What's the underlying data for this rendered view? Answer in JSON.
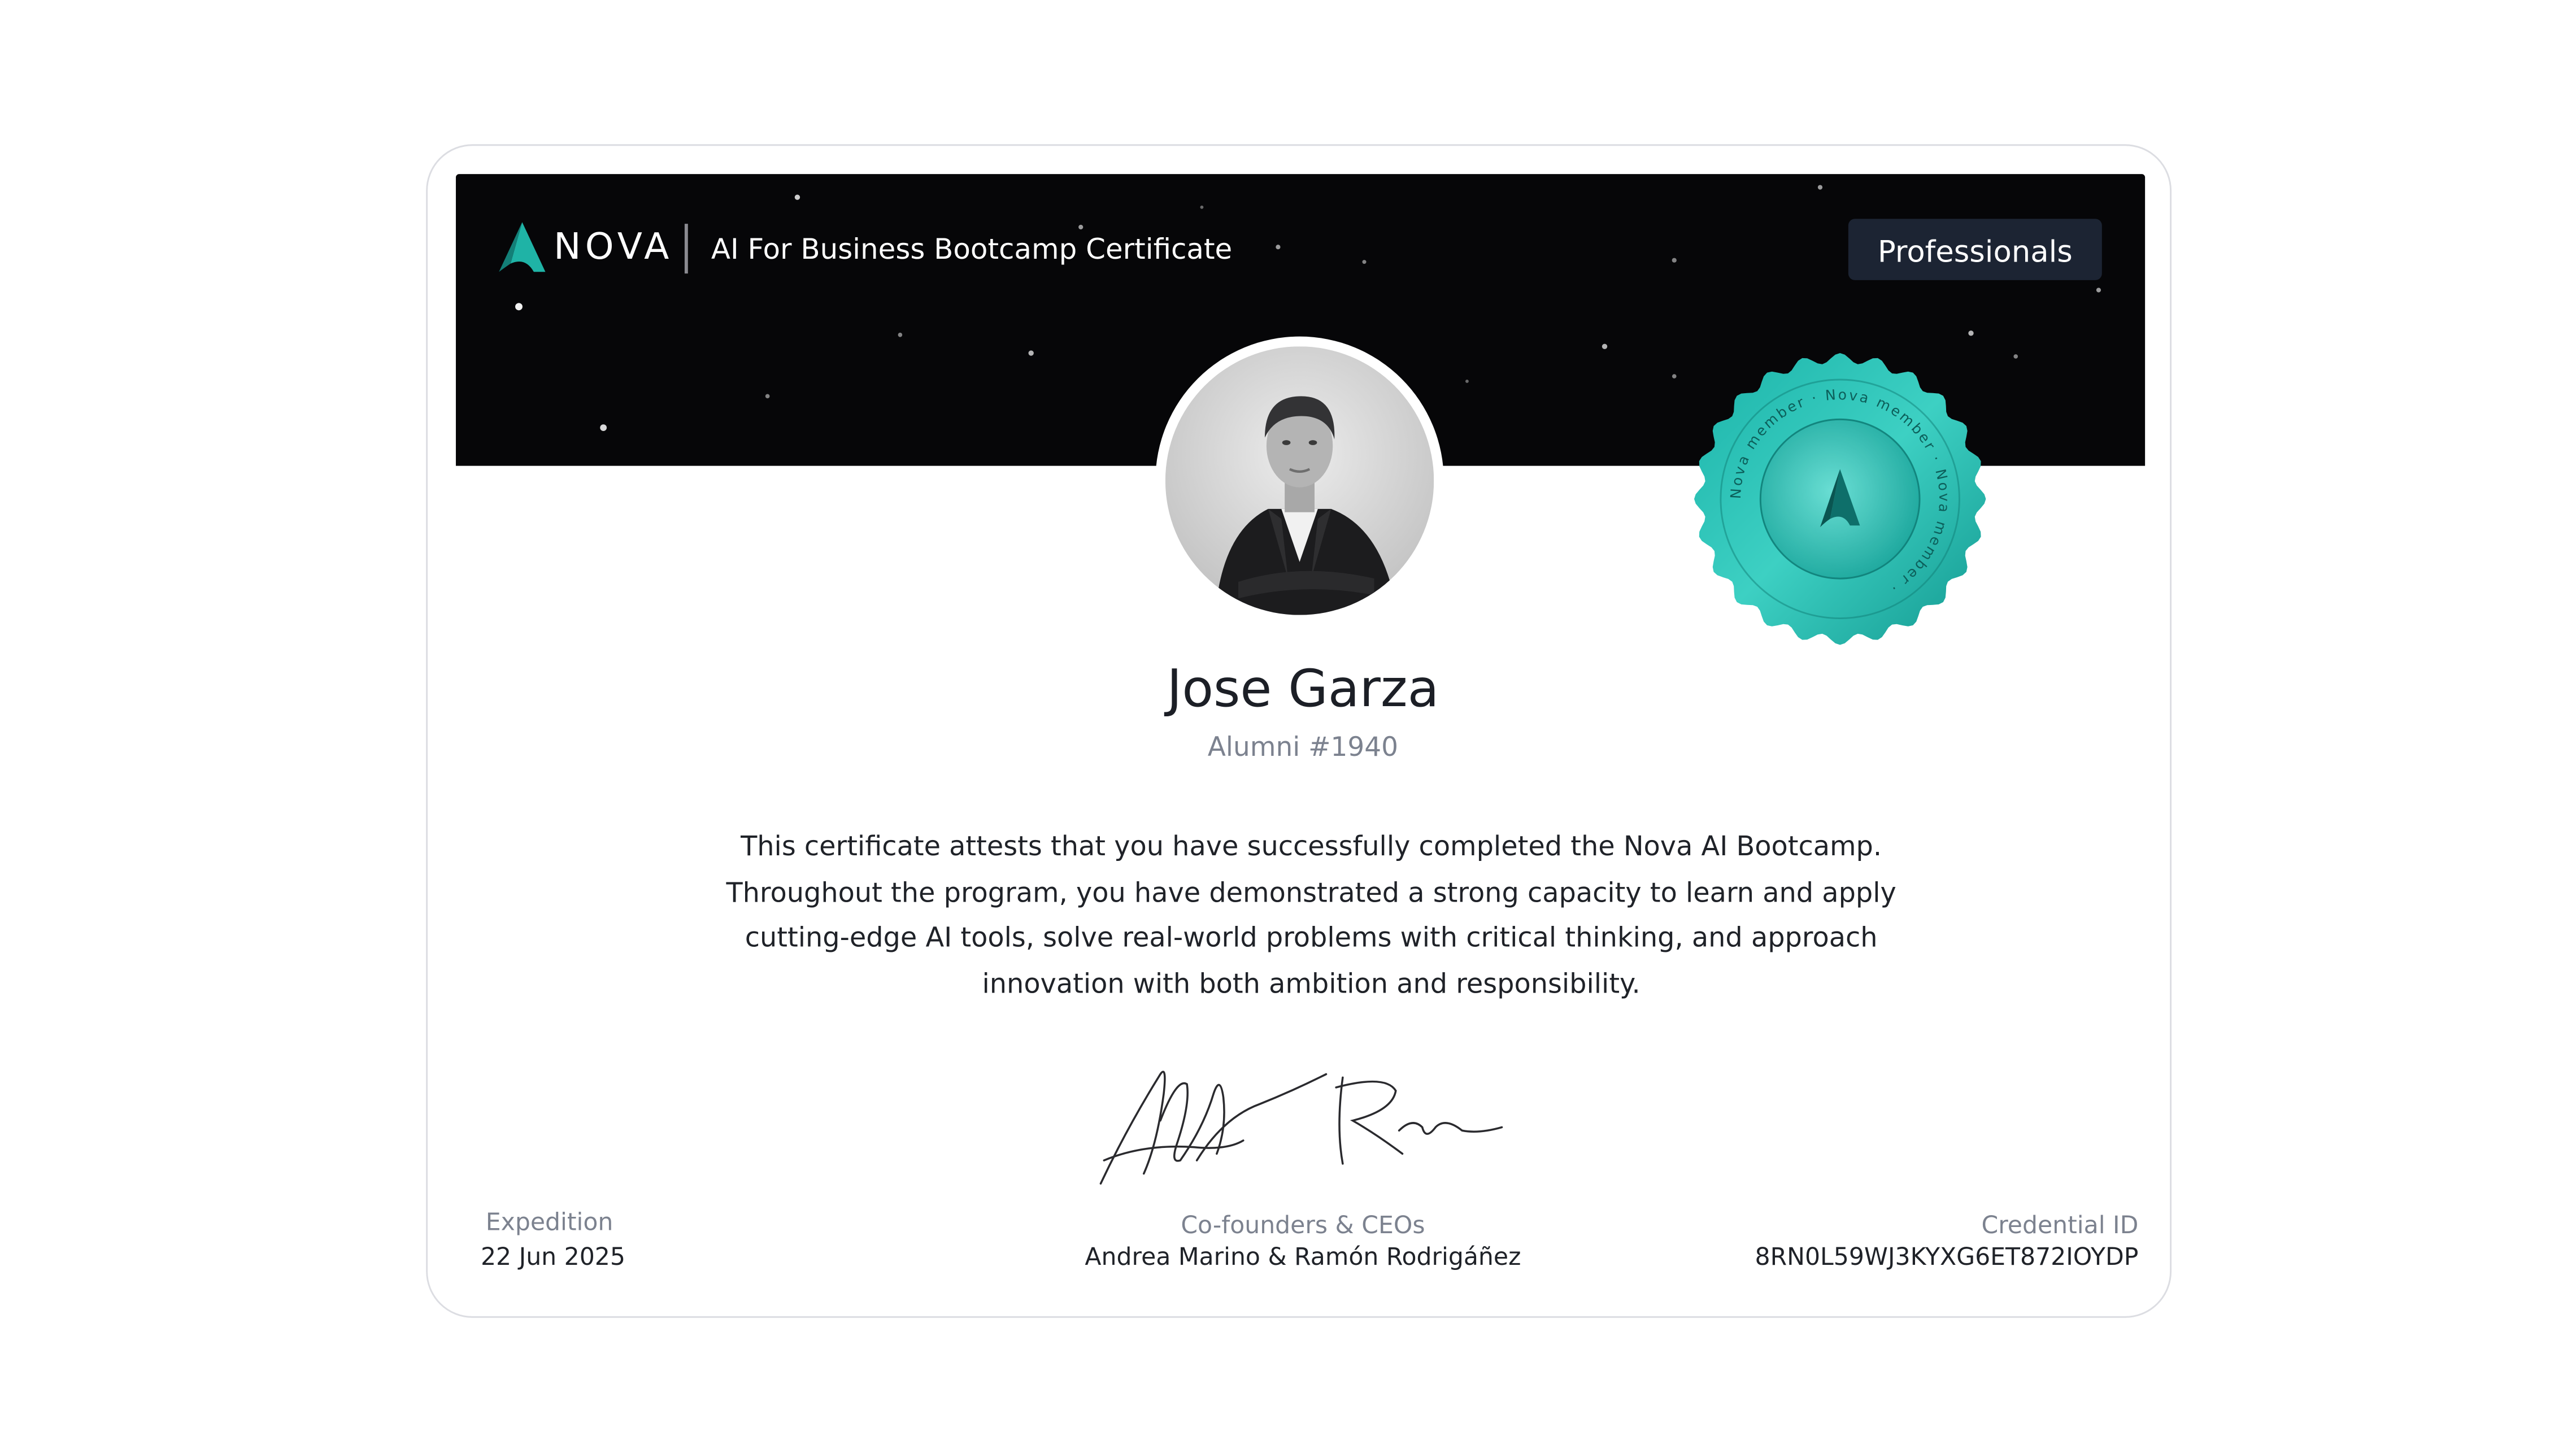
{
  "header": {
    "brand": "NOVA",
    "certificate_title": "AI For Business Bootcamp Certificate",
    "tier_badge": "Professionals"
  },
  "seal": {
    "text": "Nova member · Nova member · Nova member ·"
  },
  "recipient": {
    "name": "Jose Garza",
    "alumni_number": "Alumni #1940"
  },
  "body": {
    "statement": "This certificate attests that you have successfully completed the Nova AI Bootcamp. Throughout the program, you have demonstrated a strong capacity to learn and apply cutting-edge AI tools, solve real-world problems with critical thinking, and approach innovation with both ambition and responsibility."
  },
  "footer": {
    "expedition_label": "Expedition",
    "expedition_date": "22 Jun 2025",
    "signers_label": "Co-founders & CEOs",
    "signers_names": "Andrea Marino & Ramón Rodrigáñez",
    "credential_label": "Credential ID",
    "credential_id": "8RN0L59WJ3KYXG6ET872IOYDP"
  },
  "colors": {
    "banner": "#060608",
    "accent_teal": "#1fb3a6",
    "badge_bg": "#1c2433",
    "muted_text": "#7c828f"
  }
}
